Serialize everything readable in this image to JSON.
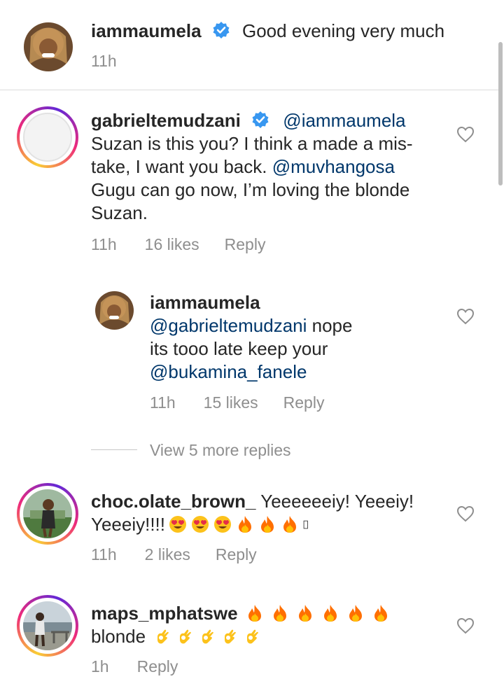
{
  "header": {
    "username": "iammaumela",
    "text": "Good evening very much",
    "time": "11h"
  },
  "comments": [
    {
      "username": "gabrieltemudzani",
      "mention": "@iammaumela",
      "lines": [
        "Suzan is this you? I think a made a mis-",
        "take, I want you back. ",
        "Gugu can go now, I’m loving the blonde",
        "Suzan."
      ],
      "inline_mention": "@muvhangosa",
      "time": "11h",
      "likes": "16 likes",
      "reply": "Reply"
    },
    {
      "username": "choc.olate_brown_",
      "text1": "Yeeeeeeiy! Yeeeiy!",
      "text2": "Yeeeiy!!!!",
      "time": "11h",
      "likes": "2 likes",
      "reply": "Reply"
    },
    {
      "username": "maps_mphatswe",
      "text2": "blonde",
      "time": "1h",
      "reply": "Reply"
    }
  ],
  "reply": {
    "username": "iammaumela",
    "mention": "@gabrieltemudzani",
    "text1": " nope",
    "text2": "its tooo late keep your",
    "mention2": "@bukamina_fanele",
    "time": "11h",
    "likes": "15 likes",
    "reply": "Reply"
  },
  "view_more": "View 5 more replies",
  "icons": [
    "verified-badge-icon",
    "heart-icon",
    "heart-eyes-emoji",
    "fire-emoji",
    "ok-hand-emoji"
  ],
  "colors": {
    "mention": "#00376b",
    "verified": "#3897f0",
    "meta": "#8e8e8e"
  }
}
